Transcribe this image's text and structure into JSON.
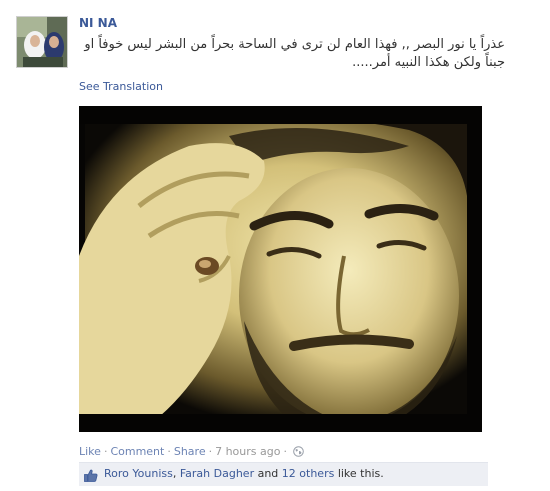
{
  "post": {
    "author": "NI NA",
    "text_line1": "عذراً يا نور البصر ,, فهذا العام لن ترى في الساحة بحراً من البشر ليس خوفاً او",
    "text_line2": "جبناً ولكن هكذا النبيه أمر.....",
    "see_translation": "See Translation"
  },
  "actions": {
    "like": "Like",
    "comment": "Comment",
    "share": "Share",
    "timestamp": "7 hours ago",
    "separator": "·",
    "privacy_icon": "globe-icon"
  },
  "likes": {
    "icon": "thumbs-up-icon",
    "person1": "Roro Youniss",
    "sep1": ", ",
    "person2": "Farah Dagher",
    "and_text": " and ",
    "others": "12 others",
    "suffix": " like this."
  },
  "colors": {
    "link": "#3b5998",
    "action_link": "#6d84b4",
    "likes_bg": "#edeff4",
    "muted": "#999999"
  }
}
